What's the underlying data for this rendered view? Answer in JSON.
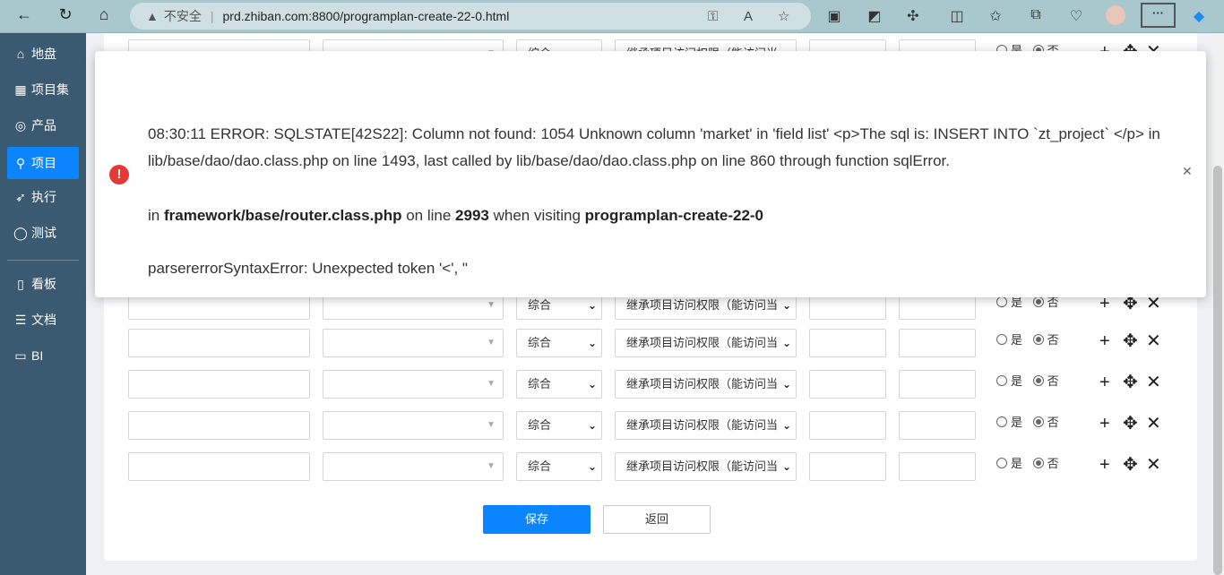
{
  "browser": {
    "security_label": "不安全",
    "url": "prd.zhiban.com:8800/programplan-create-22-0.html"
  },
  "sidebar": {
    "items": [
      {
        "label": "地盘",
        "icon": "home-icon",
        "glyph": "⌂"
      },
      {
        "label": "项目集",
        "icon": "grid-icon",
        "glyph": "▦"
      },
      {
        "label": "产品",
        "icon": "lightbulb-icon",
        "glyph": "◎"
      },
      {
        "label": "项目",
        "icon": "rocket-icon",
        "glyph": "⚲"
      },
      {
        "label": "执行",
        "icon": "running-icon",
        "glyph": "➶"
      },
      {
        "label": "测试",
        "icon": "search-icon",
        "glyph": "◯"
      },
      {
        "label": "看板",
        "icon": "kanban-icon",
        "glyph": "▯"
      },
      {
        "label": "文档",
        "icon": "document-icon",
        "glyph": "☰"
      },
      {
        "label": "BI",
        "icon": "monitor-icon",
        "glyph": "▭"
      }
    ],
    "active": "项目"
  },
  "form": {
    "type_value": "综合",
    "acl_value": "继承项目访问权限（能访问当",
    "radio_yes": "是",
    "radio_no": "否",
    "save": "保存",
    "back": "返回"
  },
  "error": {
    "line1": "08:30:11 ERROR: SQLSTATE[42S22]: Column not found: 1054 Unknown column 'market' in 'field list' <p>The sql is: INSERT INTO `zt_project` </p> in lib/base/dao/dao.class.php on line 1493, last called by lib/base/dao/dao.class.php on line 860 through function sqlError.",
    "in": "in",
    "file": "framework/base/router.class.php",
    "on_line": "on line",
    "line_no": "2993",
    "when": "when visiting",
    "module": "programplan-create-22-0",
    "parser": "parsererrorSyntaxError: Unexpected token '<', \""
  },
  "colors": {
    "accent": "#0a84ff",
    "sidebar": "#3a5a72",
    "error": "#e53935"
  }
}
